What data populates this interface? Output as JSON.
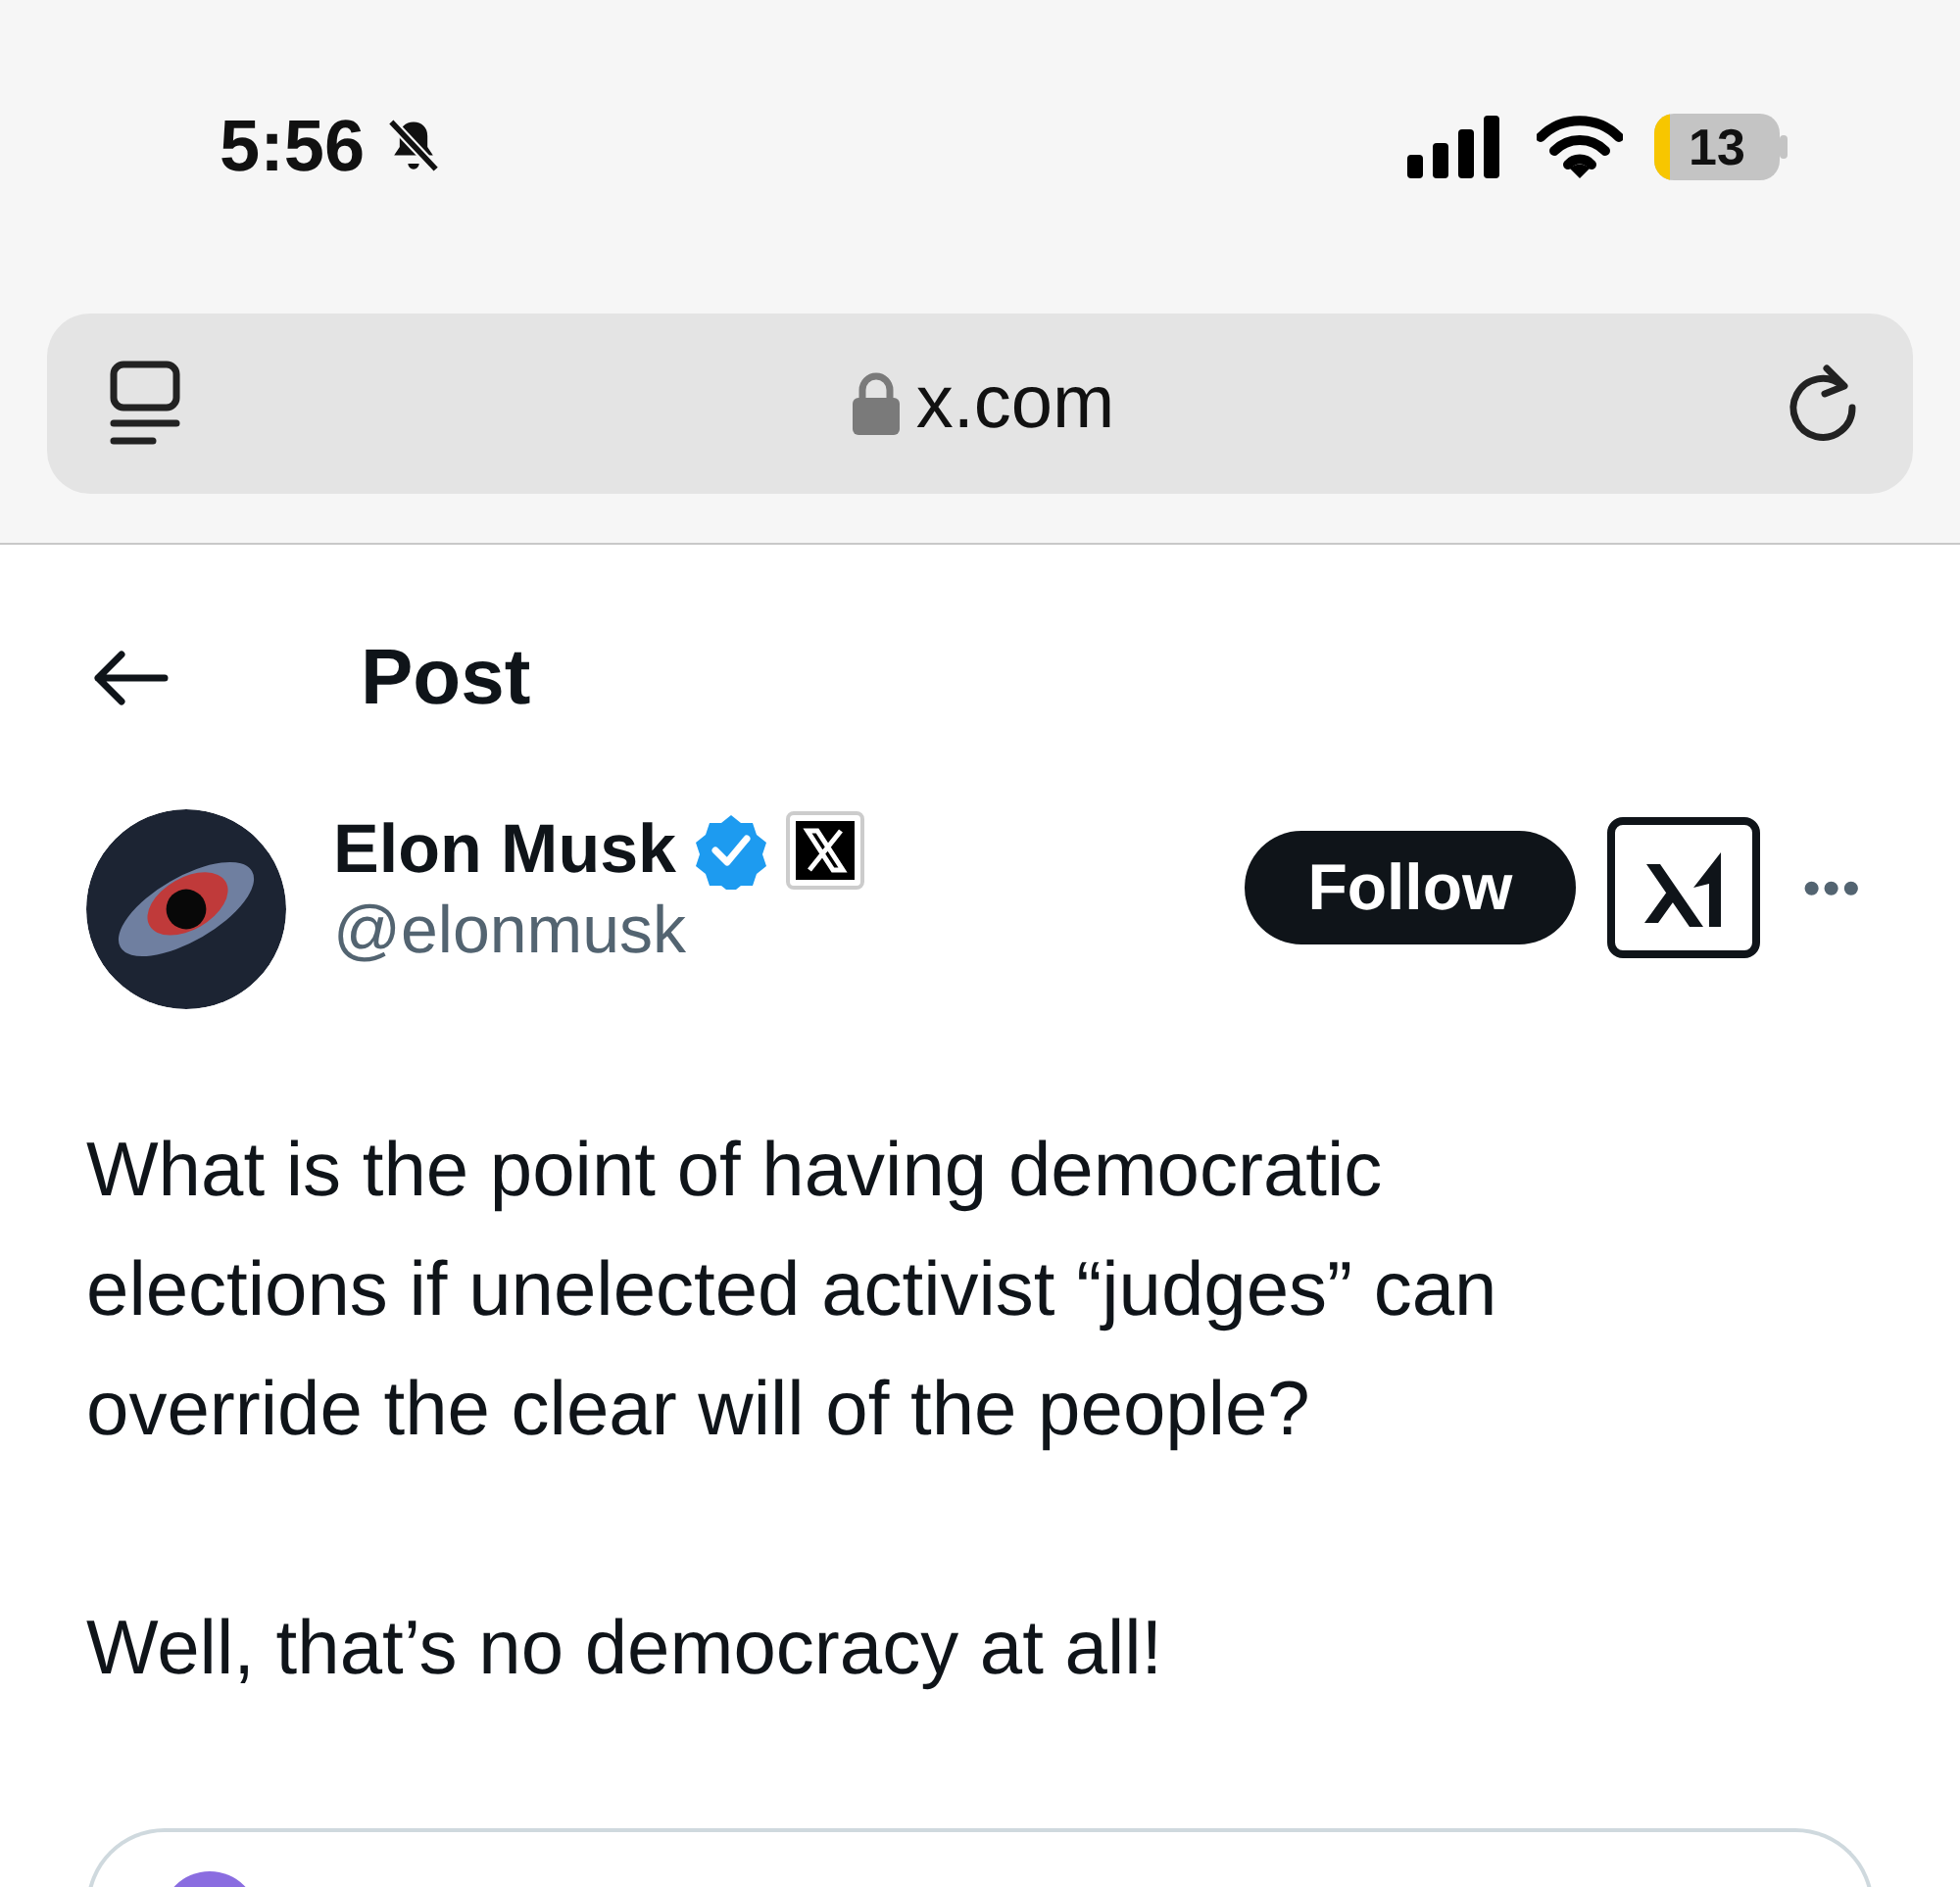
{
  "status_bar": {
    "time": "5:56",
    "battery": "13"
  },
  "address_bar": {
    "url": "x.com"
  },
  "header": {
    "title": "Post"
  },
  "post": {
    "author": "Elon Musk",
    "verified": true,
    "handle": "@elonmusk",
    "follow_button": "Follow",
    "more": "•••",
    "paragraphs": [
      "What is the point of having democratic elections if unelected activist “judges” can override the clear will of the people?",
      "Well, that’s no democracy at all!"
    ]
  }
}
